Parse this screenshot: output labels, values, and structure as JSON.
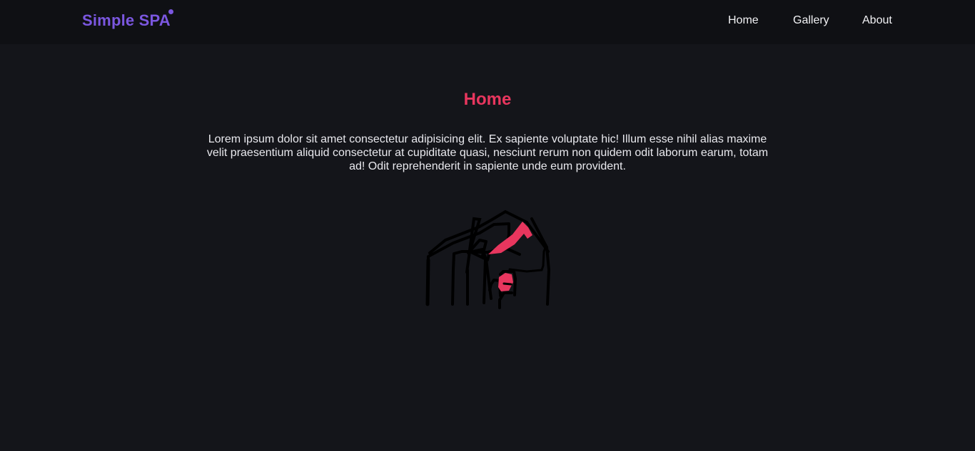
{
  "header": {
    "brand": "Simple SPA",
    "nav": [
      {
        "label": "Home"
      },
      {
        "label": "Gallery"
      },
      {
        "label": "About"
      }
    ]
  },
  "main": {
    "title": "Home",
    "paragraph": "Lorem ipsum dolor sit amet consectetur adipisicing elit. Ex sapiente voluptate hic! Illum esse nihil alias maxime velit praesentium aliquid consectetur at cupiditate quasi, nesciunt rerum non quidem odit laborum earum, totam ad! Odit reprehenderit in sapiente unde eum provident.",
    "illustration_icon": "house-sketch-icon"
  },
  "colors": {
    "background": "#14151a",
    "header_background": "#0f1014",
    "brand": "#7b57e0",
    "accent": "#e8365e",
    "text": "#e9e9ee"
  }
}
